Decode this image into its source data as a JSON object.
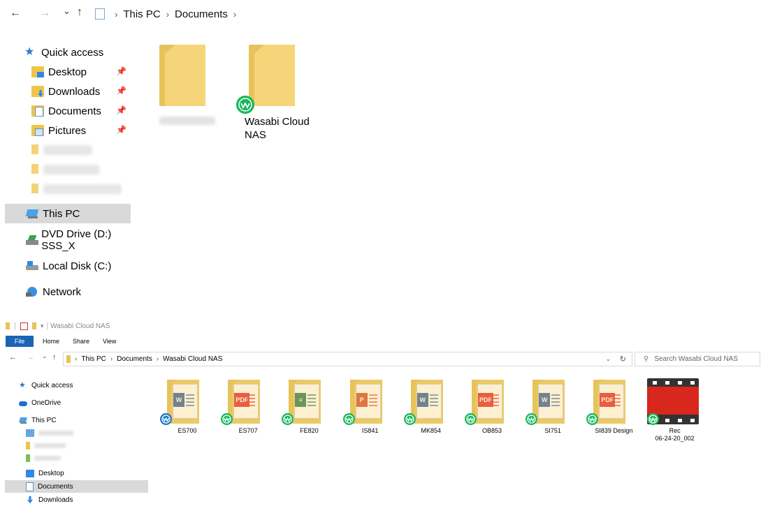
{
  "top": {
    "nav": {
      "back": "←",
      "forward": "→",
      "recent": "⌄",
      "up": "↑"
    },
    "breadcrumb": [
      "This PC",
      "Documents"
    ],
    "sidebar": {
      "quick_access": "Quick access",
      "items": [
        {
          "label": "Desktop",
          "pinned": true
        },
        {
          "label": "Downloads",
          "pinned": true
        },
        {
          "label": "Documents",
          "pinned": true
        },
        {
          "label": "Pictures",
          "pinned": true
        }
      ],
      "this_pc": "This PC",
      "dvd": "DVD Drive (D:) SSS_X",
      "local_disk": "Local Disk (C:)",
      "network": "Network"
    },
    "folders": [
      {
        "label": "",
        "blurred": true
      },
      {
        "label": "Wasabi Cloud NAS",
        "badge": "wasabi"
      }
    ]
  },
  "bottom": {
    "title": "Wasabi Cloud NAS",
    "ribbon": {
      "file": "File",
      "home": "Home",
      "share": "Share",
      "view": "View"
    },
    "breadcrumb": [
      "This PC",
      "Documents",
      "Wasabi Cloud NAS"
    ],
    "search_placeholder": "Search Wasabi Cloud NAS",
    "sidebar": {
      "quick_access": "Quick access",
      "onedrive": "OneDrive",
      "this_pc": "This PC",
      "desktop": "Desktop",
      "documents": "Documents",
      "downloads": "Downloads"
    },
    "files": [
      {
        "label": "ES700",
        "type": "word",
        "badge": "blue"
      },
      {
        "label": "ES707",
        "type": "pdf",
        "badge": "green"
      },
      {
        "label": "FE820",
        "type": "excel",
        "badge": "green"
      },
      {
        "label": "IS841",
        "type": "ppt",
        "badge": "green"
      },
      {
        "label": "MK854",
        "type": "word",
        "badge": "green"
      },
      {
        "label": "OB853",
        "type": "pdf",
        "badge": "green"
      },
      {
        "label": "SI751",
        "type": "word",
        "badge": "green"
      },
      {
        "label": "SI839 Design",
        "type": "pdf",
        "badge": "green"
      },
      {
        "label": "Rec\n06-24-20_002",
        "type": "video",
        "badge": "green"
      }
    ]
  },
  "colors": {
    "wasabi_green": "#16b85c",
    "sync_blue": "#1e78c8",
    "folder": "#f6d57a",
    "selection": "#d9d9d9"
  }
}
